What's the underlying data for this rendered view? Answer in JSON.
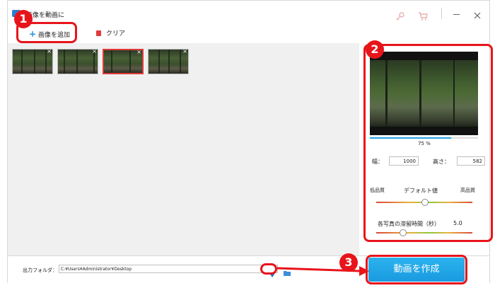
{
  "window": {
    "title": "画像を動画に"
  },
  "toolbar": {
    "add_images": "画像を追加",
    "clear": "クリア"
  },
  "thumbnails": [
    {
      "selected": false
    },
    {
      "selected": false
    },
    {
      "selected": true
    },
    {
      "selected": false
    }
  ],
  "preview": {
    "progress_label": "75 %",
    "progress_value": 0.75,
    "width_label": "幅：",
    "width_value": "1000",
    "height_label": "高さ：",
    "height_value": "582"
  },
  "quality": {
    "low_label": "低品質",
    "high_label": "高品質",
    "default_label": "デフォルト値",
    "level": 0.5
  },
  "duration": {
    "label": "各写真の滞留時間（秒）",
    "value": "5.0",
    "level": 0.27
  },
  "output": {
    "folder_label": "出力フォルダ：",
    "path": "C:¥Users¥Administrator¥Desktop"
  },
  "create_button": {
    "label": "動画を作成"
  },
  "callouts": {
    "one": "1",
    "two": "2",
    "three": "3"
  },
  "colors": {
    "accent_blue": "#1fa3e6",
    "callout_red": "#e8141b"
  }
}
